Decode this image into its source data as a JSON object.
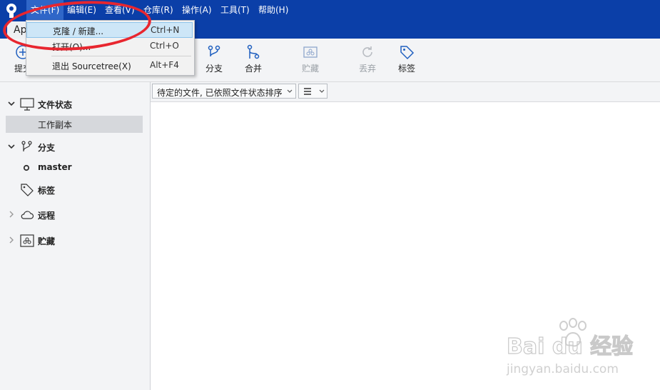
{
  "menubar": {
    "items": [
      "文件(F)",
      "编辑(E)",
      "查看(V)",
      "仓库(R)",
      "操作(A)",
      "工具(T)",
      "帮助(H)"
    ]
  },
  "tab": {
    "label": "Ap"
  },
  "file_menu": {
    "items": [
      {
        "label": "克隆 / 新建...",
        "shortcut": "Ctrl+N"
      },
      {
        "label": "打开(O)...",
        "shortcut": "Ctrl+O"
      },
      {
        "label": "退出 Sourcetree(X)",
        "shortcut": "Alt+F4"
      }
    ]
  },
  "toolbar": {
    "commit_label": "提交",
    "branch_label": "分支",
    "merge_label": "合并",
    "stash_label": "贮藏",
    "discard_label": "丢弃",
    "tag_label": "标签"
  },
  "sidebar": {
    "file_status": "文件状态",
    "working_copy": "工作副本",
    "branches": "分支",
    "master": "master",
    "tags": "标签",
    "remotes": "远程",
    "stashes": "贮藏"
  },
  "content": {
    "filter_label": "待定的文件, 已依照文件状态排序"
  },
  "watermark": {
    "brand": "Bai du 经验",
    "url": "jingyan.baidu.com"
  },
  "colors": {
    "titlebar": "#0b3fa8",
    "menu_highlight": "#cde6f7",
    "annotation": "#e8262f"
  }
}
